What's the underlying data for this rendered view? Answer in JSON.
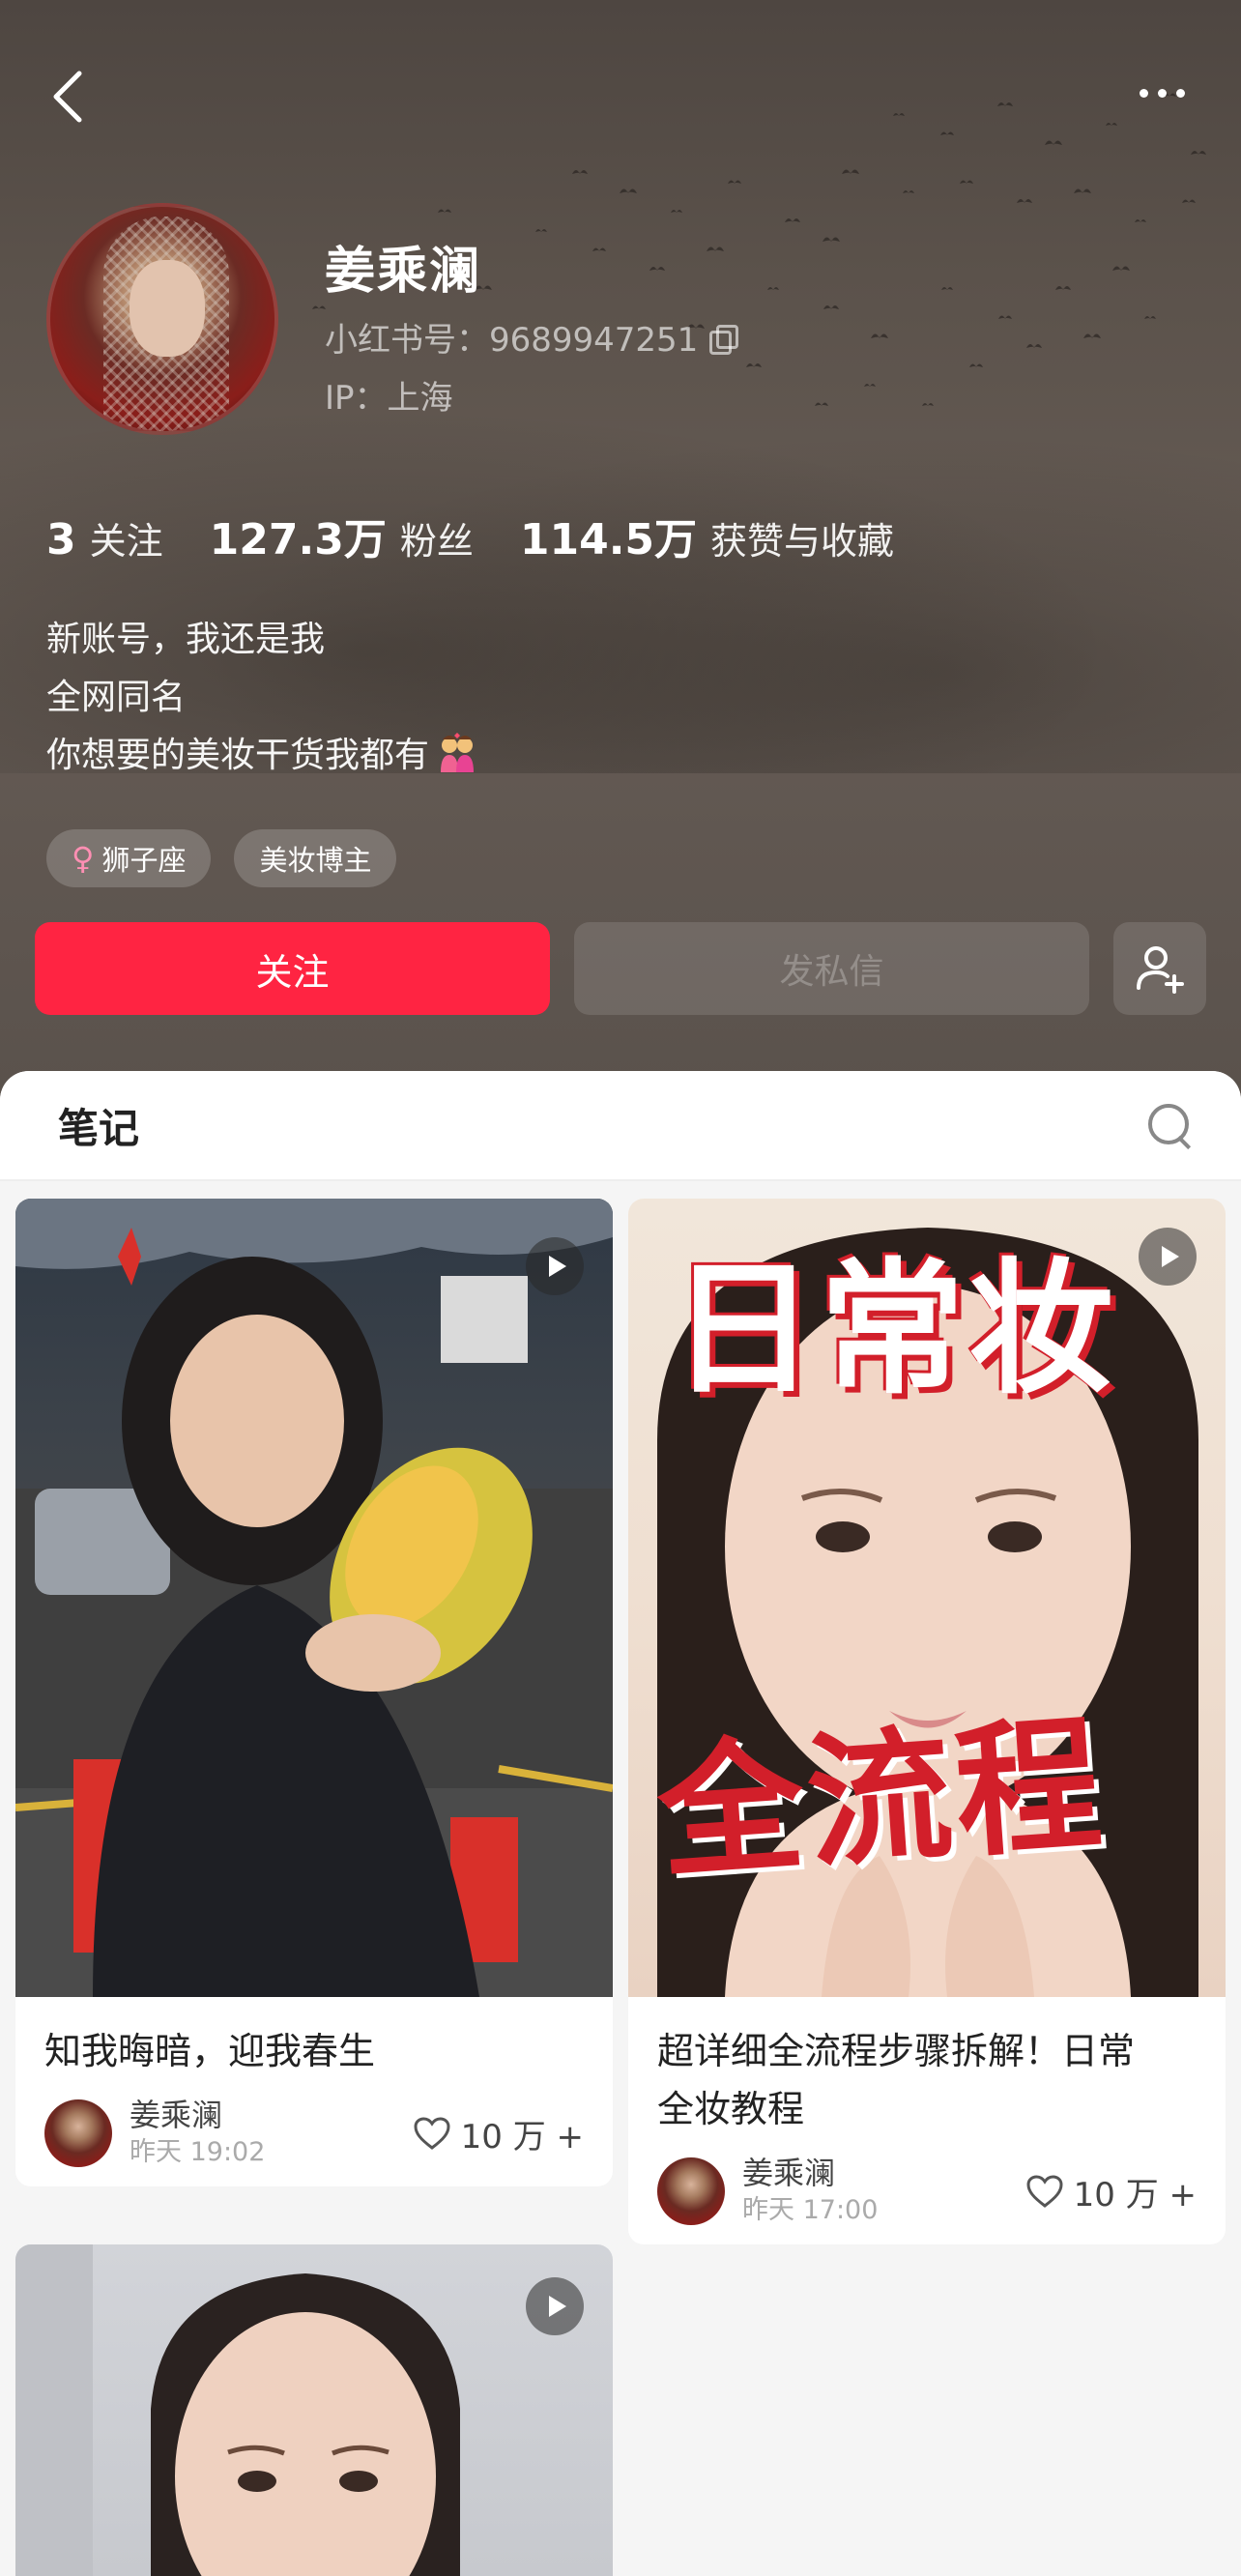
{
  "profile": {
    "name": "姜乘澜",
    "red_id": "小红书号：9689947251",
    "ip": "IP：上海",
    "stats": [
      {
        "num": "3",
        "label": "关注"
      },
      {
        "num": "127.3万",
        "label": "粉丝"
      },
      {
        "num": "114.5万",
        "label": "获赞与收藏"
      }
    ],
    "bio": [
      "新账号，我还是我",
      "全网同名",
      "你想要的美妆干货我都有"
    ],
    "tags": [
      "狮子座",
      "美妆博主"
    ],
    "follow_label": "关注",
    "message_label": "发私信"
  },
  "notes": {
    "title": "笔记",
    "cards": [
      {
        "title": "知我晦暗，迎我春生",
        "author": "姜乘澜",
        "time": "昨天 19:02",
        "likes": "10 万 +"
      },
      {
        "title_line1": "超详细全流程步骤拆解！日常",
        "title_line2": "全妆教程",
        "cover_text_top": "日常妆",
        "cover_text_bottom": "全流程",
        "author": "姜乘澜",
        "time": "昨天 17:00",
        "likes": "10 万 +"
      },
      {}
    ]
  },
  "colors": {
    "accent": "#ff2442",
    "header_bg": "#5b524b"
  },
  "icons": [
    "back-icon",
    "more-icon",
    "copy-icon",
    "female-icon",
    "add-friend-icon",
    "search-icon",
    "play-icon",
    "heart-icon"
  ]
}
